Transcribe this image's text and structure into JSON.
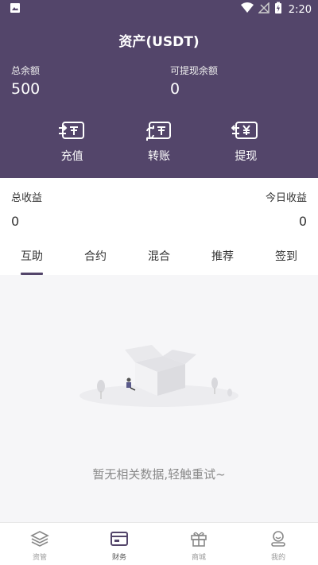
{
  "status": {
    "time": "2:20"
  },
  "header": {
    "title": "资产(USDT)"
  },
  "balances": {
    "total_label": "总余额",
    "total_value": "500",
    "withdrawable_label": "可提现余额",
    "withdrawable_value": "0"
  },
  "actions": [
    {
      "label": "充值",
      "icon": "recharge-icon"
    },
    {
      "label": "转账",
      "icon": "transfer-icon"
    },
    {
      "label": "提现",
      "icon": "withdraw-icon"
    }
  ],
  "earnings": {
    "total_label": "总收益",
    "total_value": "0",
    "today_label": "今日收益",
    "today_value": "0"
  },
  "tabs": [
    {
      "label": "互助",
      "active": true
    },
    {
      "label": "合约"
    },
    {
      "label": "混合"
    },
    {
      "label": "推荐"
    },
    {
      "label": "签到"
    }
  ],
  "empty": {
    "message": "暂无相关数据,轻触重试~"
  },
  "bottom_nav": [
    {
      "label": "资管",
      "icon": "layers-icon"
    },
    {
      "label": "财务",
      "icon": "wallet-icon",
      "active": true
    },
    {
      "label": "商城",
      "icon": "gift-icon"
    },
    {
      "label": "我的",
      "icon": "profile-icon"
    }
  ],
  "colors": {
    "primary": "#53456a",
    "background": "#f6f6f8"
  }
}
